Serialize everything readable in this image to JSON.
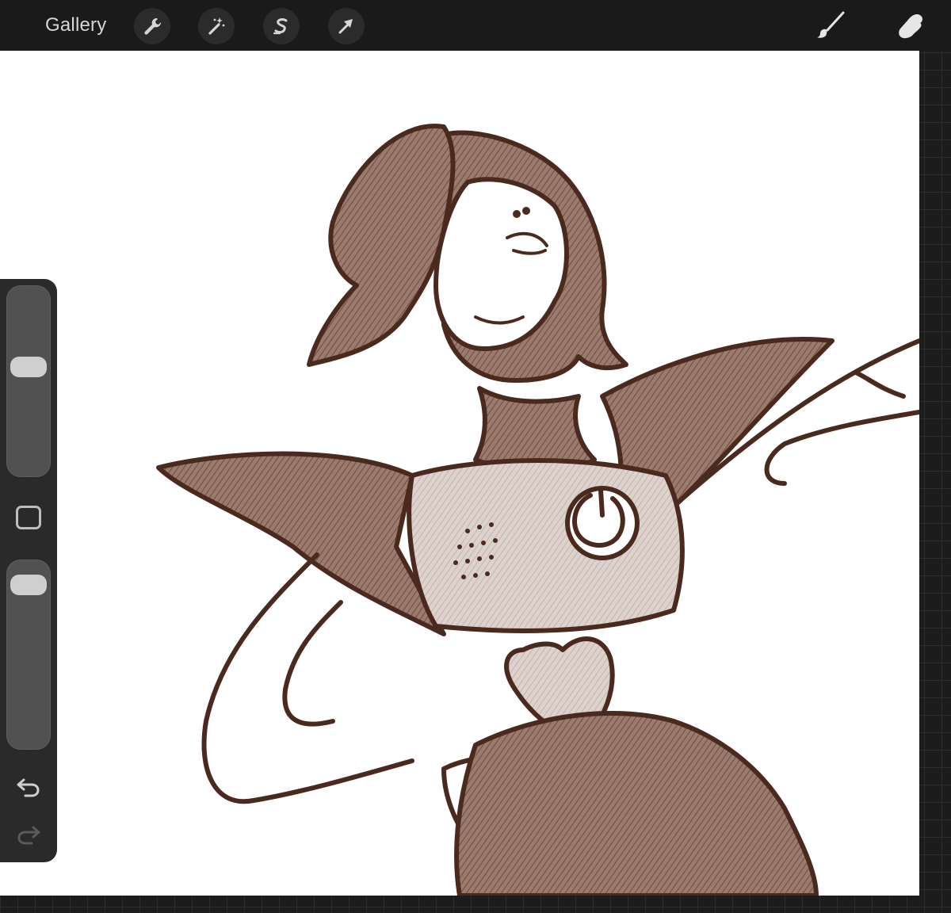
{
  "toolbar": {
    "gallery_label": "Gallery",
    "left_tools": [
      {
        "name": "actions",
        "icon": "wrench-icon"
      },
      {
        "name": "adjustments",
        "icon": "magic-wand-icon"
      },
      {
        "name": "selection",
        "icon": "selection-s-icon"
      },
      {
        "name": "transform",
        "icon": "arrow-cursor-icon"
      }
    ],
    "right_tools": [
      {
        "name": "brush",
        "icon": "brush-icon"
      },
      {
        "name": "smudge",
        "icon": "smudge-finger-icon"
      }
    ]
  },
  "sidebar": {
    "brush_size_level": 0.41,
    "opacity_level": 0.07,
    "modify_button_icon": "square-icon",
    "undo_icon": "undo-icon",
    "redo_icon": "redo-icon"
  },
  "colors": {
    "ink": "#4a2a1e",
    "fill": "#8a6a5c",
    "toolbar": "#1a1a1a",
    "canvas": "#ffffff"
  }
}
